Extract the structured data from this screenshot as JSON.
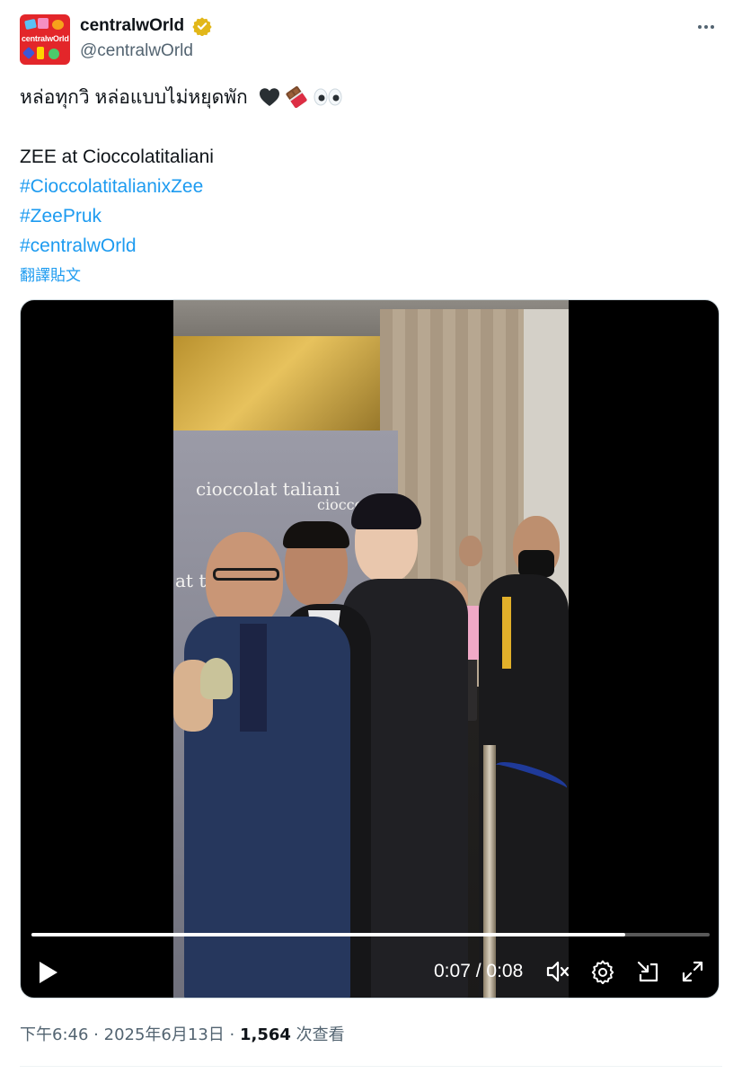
{
  "account": {
    "display_name": "centralwOrld",
    "handle": "@centralwOrld",
    "avatar_text": "centralwOrld",
    "verified_color": "#e2b719"
  },
  "post": {
    "line1": "หล่อทุกวิ หล่อแบบไม่หยุดพัก",
    "line1_emojis": [
      "black-heart",
      "chocolate-bar",
      "eyes"
    ],
    "line2": "ZEE at Cioccolatitaliani",
    "hashtags": [
      "#CioccolatitalianixZee",
      "#ZeePruk",
      "#centralwOrld"
    ],
    "translate_label": "翻譯貼文"
  },
  "video": {
    "brand_text_1": "cioccolat taliani",
    "brand_text_2": "cioccolat",
    "brand_text_3": "at tali",
    "current_time": "0:07",
    "separator": "/",
    "duration": "0:08",
    "progress_fraction": 0.875
  },
  "meta": {
    "time": "下午6:46",
    "date": "2025年6月13日",
    "views_count": "1,564",
    "views_label": "次查看",
    "dot": "·"
  },
  "colors": {
    "link": "#1d9bf0",
    "secondary_text": "#536471",
    "avatar_red": "#e3262a"
  }
}
